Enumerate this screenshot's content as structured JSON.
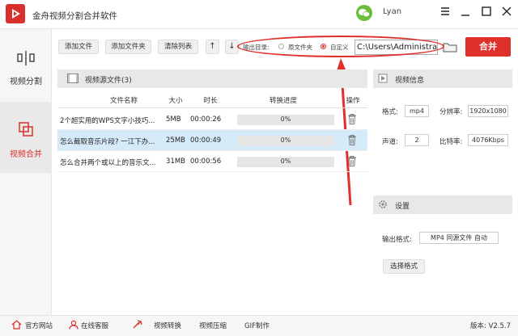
{
  "app": {
    "title": "金舟视频分割合并软件",
    "username": "Lyan"
  },
  "sidebar": {
    "items": [
      {
        "label": "视频分割"
      },
      {
        "label": "视频合并"
      }
    ]
  },
  "toolbar": {
    "add_file": "添加文件",
    "add_folder": "添加文件夹",
    "clear_list": "清除列表",
    "up": "↑",
    "down": "↓",
    "output_dir_label": "输出目录:",
    "radio_source": "原文件夹",
    "radio_custom": "自定义",
    "path_value": "C:\\Users\\Administrator\\",
    "merge_label": "合并"
  },
  "files": {
    "header": "视频源文件(3)",
    "columns": [
      "文件名称",
      "大小",
      "时长",
      "转换进度",
      "操作"
    ],
    "rows": [
      {
        "name": "2个超实用的WPS文字小技巧...",
        "size": "5MB",
        "duration": "00:00:26",
        "progress": "0%"
      },
      {
        "name": "怎么截取音乐片段? 一江下办...",
        "size": "25MB",
        "duration": "00:00:49",
        "progress": "0%"
      },
      {
        "name": "怎么合并两个或以上的音乐文...",
        "size": "31MB",
        "duration": "00:00:56",
        "progress": "0%"
      }
    ]
  },
  "video_info": {
    "header": "视频信息",
    "format_label": "格式:",
    "format_value": "mp4",
    "resolution_label": "分辨率:",
    "resolution_value": "1920x1080",
    "channel_label": "声道:",
    "channel_value": "2",
    "bitrate_label": "比特率:",
    "bitrate_value": "4076Kbps"
  },
  "settings": {
    "header": "设置",
    "output_format_label": "输出格式:",
    "output_format_value": "MP4 同源文件 自动",
    "choose_format": "选择格式"
  },
  "footer": {
    "items": [
      "官方网站",
      "在线客服",
      "视频转换",
      "视频压缩",
      "GIF制作"
    ],
    "version": "版本: V2.5.7"
  },
  "colors": {
    "accent": "#d9302b",
    "selected_row": "#d6ebfa"
  }
}
